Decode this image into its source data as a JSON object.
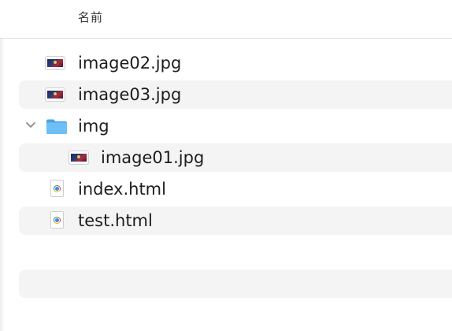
{
  "header": {
    "column_name": "名前"
  },
  "files": [
    {
      "name": "image02.jpg",
      "icon": "image-file-icon"
    },
    {
      "name": "image03.jpg",
      "icon": "image-file-icon"
    },
    {
      "name": "img",
      "icon": "folder-icon",
      "expanded": true
    },
    {
      "name": "image01.jpg",
      "icon": "image-file-icon"
    },
    {
      "name": "index.html",
      "icon": "html-file-icon"
    },
    {
      "name": "test.html",
      "icon": "html-file-icon"
    }
  ],
  "colors": {
    "stripe": "#f4f4f4",
    "folder": "#5ab4ee",
    "text": "#1d1d1f"
  }
}
